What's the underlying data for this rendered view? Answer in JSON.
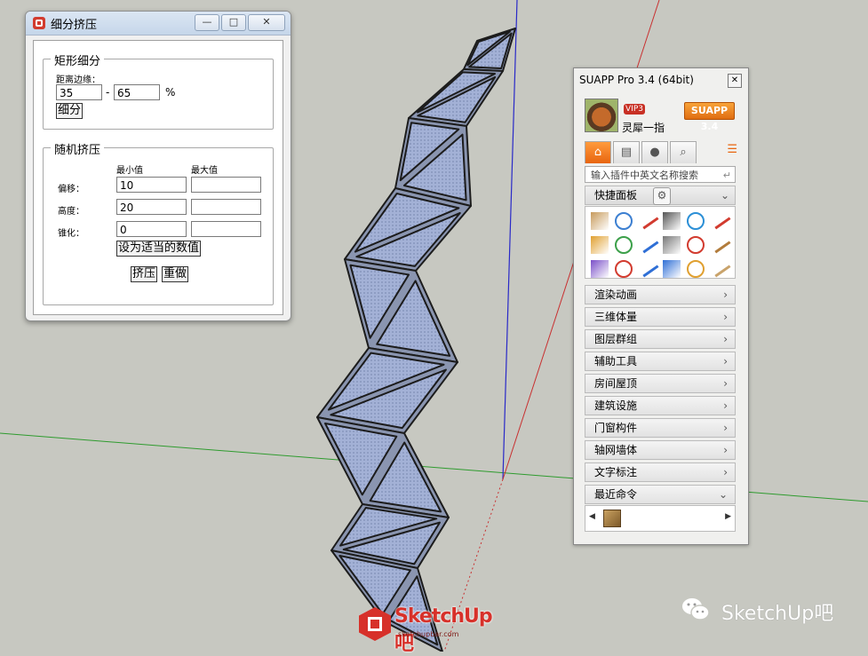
{
  "dialog": {
    "title": "细分挤压",
    "win_min": "—",
    "win_max": "□",
    "win_close": "✕",
    "subdivide": {
      "legend": "矩形细分",
      "edge_label": "距离边缘：",
      "from_value": "35",
      "dash": "-",
      "to_value": "65",
      "percent": "%",
      "button": "细分"
    },
    "extrude": {
      "legend": "随机挤压",
      "min_header": "最小值",
      "max_header": "最大值",
      "rows": [
        {
          "label": "偏移：",
          "min": "10",
          "max": ""
        },
        {
          "label": "高度：",
          "min": "20",
          "max": ""
        },
        {
          "label": "锥化：",
          "min": "0",
          "max": ""
        }
      ],
      "suggest_button": "设为适当的数值",
      "extrude_button": "挤压",
      "redo_button": "重做"
    }
  },
  "panel": {
    "title": "SUAPP Pro 3.4 (64bit)",
    "close": "✕",
    "vip": "VIP3",
    "username": "灵犀一指",
    "version_badge": "SUAPP 3.4",
    "tabs": [
      {
        "name": "home",
        "glyph": "⌂"
      },
      {
        "name": "keyboard",
        "glyph": "▤"
      },
      {
        "name": "user",
        "glyph": "●"
      },
      {
        "name": "search",
        "glyph": "⌕"
      }
    ],
    "menu_glyph": "☰",
    "search_placeholder": "输入插件中英文名称搜索",
    "search_enter": "↵",
    "quick_panel": "快捷面板",
    "gear_glyph": "⚙",
    "collapse_glyph": "⌄",
    "expand_glyph": "›",
    "categories": [
      "渲染动画",
      "三维体量",
      "图层群组",
      "辅助工具",
      "房间屋顶",
      "建筑设施",
      "门窗构件",
      "轴网墙体",
      "文字标注"
    ],
    "recent": "最近命令",
    "left_arrow": "◀",
    "right_arrow": "▶"
  },
  "watermark": {
    "brand": "SketchUp吧",
    "url": "sketchupbar.com",
    "wechat_text": "SketchUp吧"
  },
  "colors": {
    "viewport_bg": "#c7c8c1",
    "accent_orange": "#e8650f",
    "brand_red": "#d7312a",
    "surface_blue": "#9aa9cf"
  }
}
